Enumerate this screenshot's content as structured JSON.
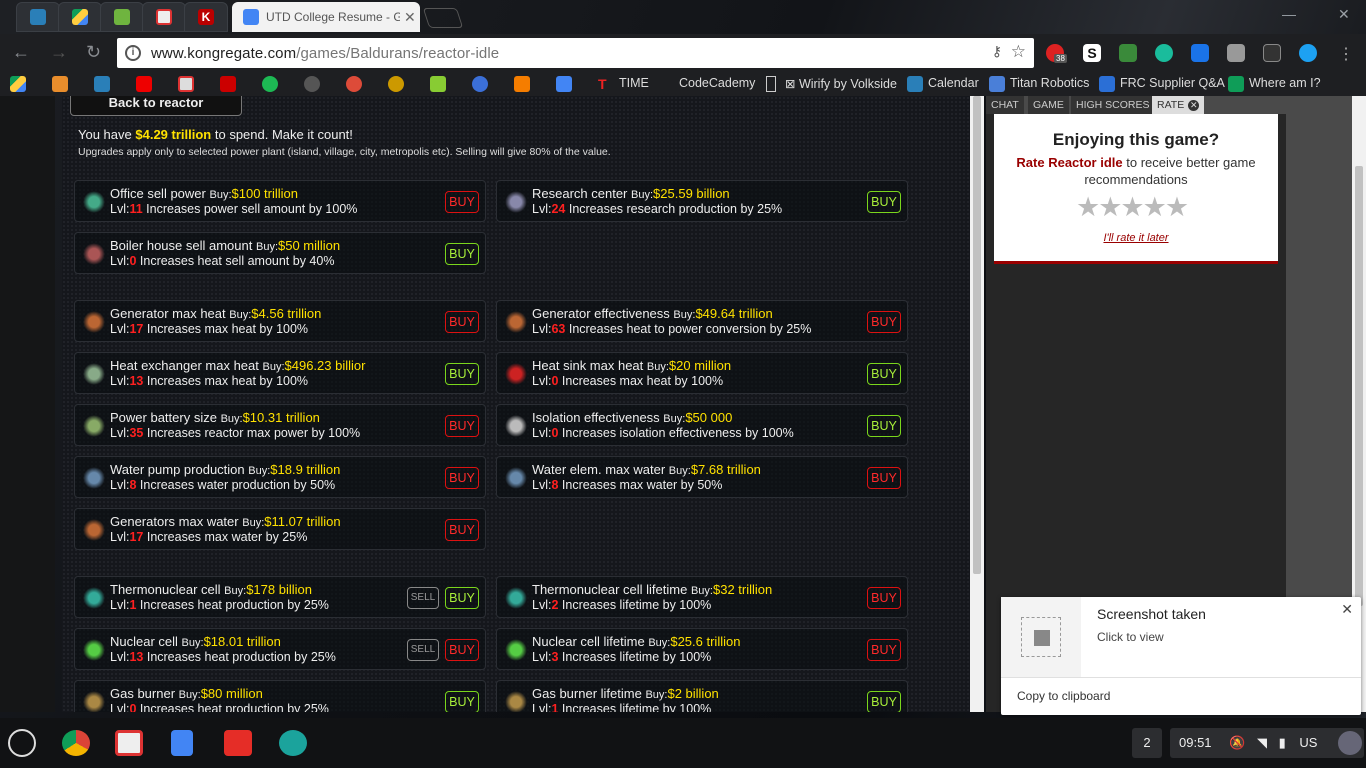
{
  "browser": {
    "active_tab_title": "UTD College Resume - G",
    "url_host": "www.kongregate.com",
    "url_path": "/games/Baldurans/reactor-idle",
    "extension_badge": "38"
  },
  "bookmarks": [
    "TIME",
    "CodeCademy",
    "⊠ Wirify by Volkside",
    "Calendar",
    "Titan Robotics",
    "FRC Supplier Q&A",
    "Where am I?"
  ],
  "game": {
    "back_label": "Back to reactor",
    "money_prefix": "You have",
    "money_amount": "$4.29 trillion",
    "money_suffix": "to spend. Make it count!",
    "note": "Upgrades apply only to selected power plant (island, village, city, metropolis etc). Selling will give 80% of the value.",
    "buy_prefix": "Buy:",
    "lvl_prefix": "Lvl:",
    "buy_label": "BUY",
    "sell_label": "SELL",
    "upgrades": [
      {
        "name": "Office sell power",
        "price": "$100 trillion",
        "lvl": "11",
        "desc": "Increases power sell amount by 100%",
        "state": "red"
      },
      {
        "name": "Research center",
        "price": "$25.59 billion",
        "lvl": "24",
        "desc": "Increases research production by 25%",
        "state": "green"
      },
      {
        "name": "Boiler house sell amount",
        "price": "$50 million",
        "lvl": "0",
        "desc": "Increases heat sell amount by 40%",
        "state": "green"
      },
      {
        "name": "Generator max heat",
        "price": "$4.56 trillion",
        "lvl": "17",
        "desc": "Increases max heat by 100%",
        "state": "red"
      },
      {
        "name": "Generator effectiveness",
        "price": "$49.64 trillion",
        "lvl": "63",
        "desc": "Increases heat to power conversion by 25%",
        "state": "red"
      },
      {
        "name": "Heat exchanger max heat",
        "price": "$496.23 billior",
        "lvl": "13",
        "desc": "Increases max heat by 100%",
        "state": "green"
      },
      {
        "name": "Heat sink max heat",
        "price": "$20 million",
        "lvl": "0",
        "desc": "Increases max heat by 100%",
        "state": "green"
      },
      {
        "name": "Power battery size",
        "price": "$10.31 trillion",
        "lvl": "35",
        "desc": "Increases reactor max power by 100%",
        "state": "red"
      },
      {
        "name": "Isolation effectiveness",
        "price": "$50 000",
        "lvl": "0",
        "desc": "Increases isolation effectiveness by 100%",
        "state": "green"
      },
      {
        "name": "Water pump production",
        "price": "$18.9 trillion",
        "lvl": "8",
        "desc": "Increases water production by 50%",
        "state": "red"
      },
      {
        "name": "Water elem. max water",
        "price": "$7.68 trillion",
        "lvl": "8",
        "desc": "Increases max water by 50%",
        "state": "red"
      },
      {
        "name": "Generators max water",
        "price": "$11.07 trillion",
        "lvl": "17",
        "desc": "Increases max water by 25%",
        "state": "red"
      },
      {
        "name": "Thermonuclear cell",
        "price": "$178 billion",
        "lvl": "1",
        "desc": "Increases heat production by 25%",
        "state": "green",
        "sell": true
      },
      {
        "name": "Thermonuclear cell lifetime",
        "price": "$32 trillion",
        "lvl": "2",
        "desc": "Increases lifetime by 100%",
        "state": "red"
      },
      {
        "name": "Nuclear cell",
        "price": "$18.01 trillion",
        "lvl": "13",
        "desc": "Increases heat production by 25%",
        "state": "red",
        "sell": true
      },
      {
        "name": "Nuclear cell lifetime",
        "price": "$25.6 trillion",
        "lvl": "3",
        "desc": "Increases lifetime by 100%",
        "state": "red"
      },
      {
        "name": "Gas burner",
        "price": "$80 million",
        "lvl": "0",
        "desc": "Increases heat production by 25%",
        "state": "green"
      },
      {
        "name": "Gas burner lifetime",
        "price": "$2 billion",
        "lvl": "1",
        "desc": "Increases lifetime by 100%",
        "state": "green"
      }
    ]
  },
  "sidebar": {
    "tabs": [
      "CHAT",
      "GAME",
      "HIGH SCORES",
      "RATE"
    ],
    "rate_title": "Enjoying this game?",
    "rate_game": "Rate Reactor idle",
    "rate_rest": "to receive better game recommendations",
    "stars": "★★★★★",
    "rate_later": "I'll rate it later"
  },
  "notification": {
    "title": "Screenshot taken",
    "subtitle": "Click to view",
    "action": "Copy to clipboard"
  },
  "shelf": {
    "notif_count": "2",
    "time": "09:51",
    "ime": "US"
  },
  "colors": {
    "accent_yellow": "#ffe100",
    "level_red": "#ff2020",
    "buy_green": "#a8f03a",
    "buy_red": "#ff2a2a"
  }
}
